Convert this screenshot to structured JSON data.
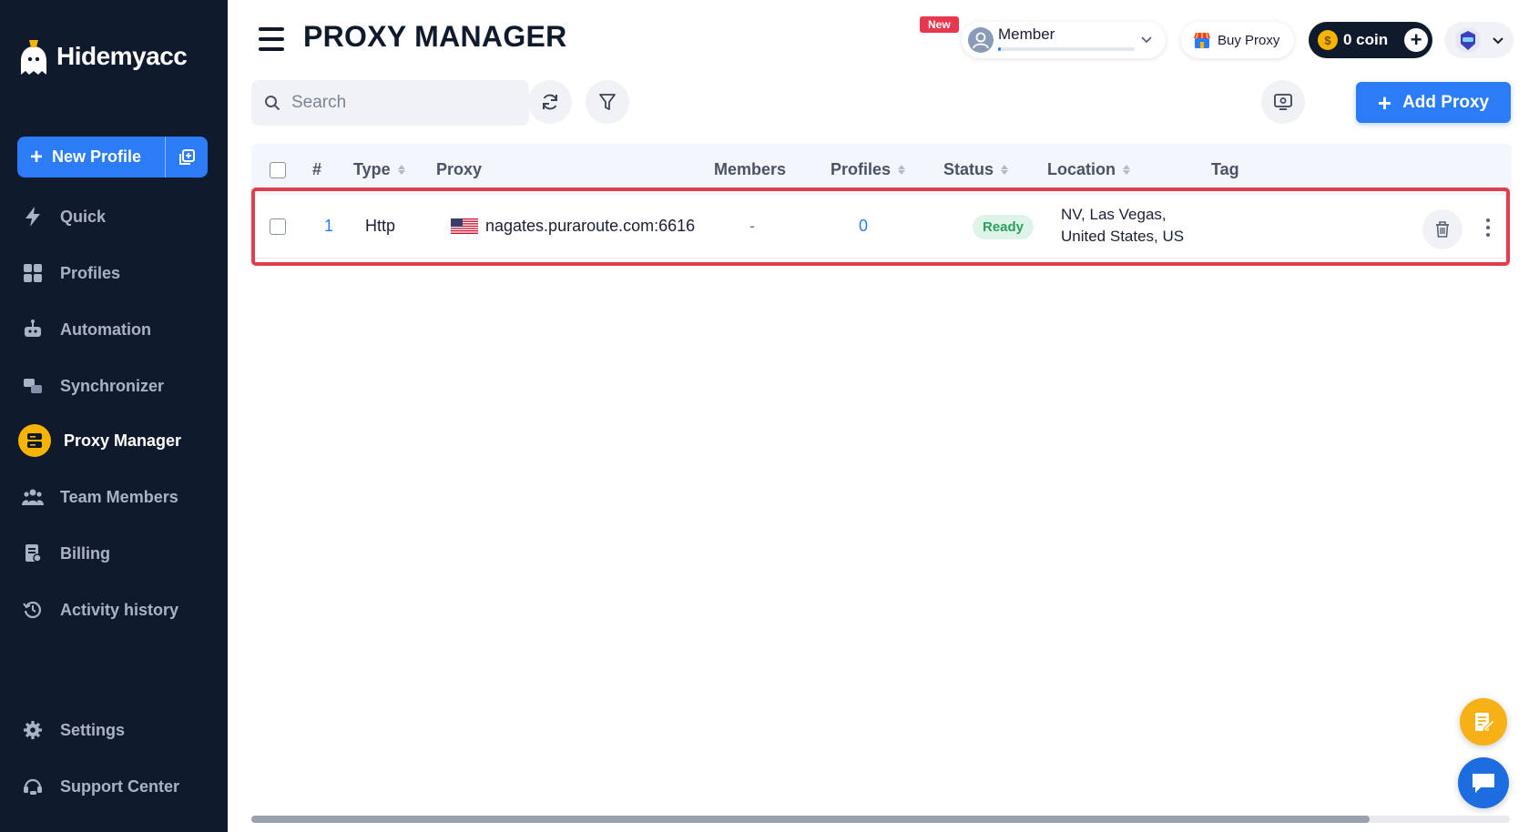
{
  "brand": {
    "name": "Hidemyacc"
  },
  "sidebar": {
    "new_profile_label": "New Profile",
    "items": [
      {
        "label": "Quick",
        "icon": "bolt-icon"
      },
      {
        "label": "Profiles",
        "icon": "grid-icon"
      },
      {
        "label": "Automation",
        "icon": "robot-icon"
      },
      {
        "label": "Synchronizer",
        "icon": "sync-icon"
      },
      {
        "label": "Proxy Manager",
        "icon": "server-icon",
        "active": true
      },
      {
        "label": "Team Members",
        "icon": "team-icon"
      },
      {
        "label": "Billing",
        "icon": "billing-icon"
      },
      {
        "label": "Activity history",
        "icon": "history-icon"
      },
      {
        "label": "Settings",
        "icon": "gear-icon"
      },
      {
        "label": "Support Center",
        "icon": "support-icon"
      }
    ]
  },
  "header": {
    "title": "PROXY MANAGER",
    "new_badge": "New",
    "member_label": "Member",
    "buy_proxy_label": "Buy Proxy",
    "coin_label": "0 coin"
  },
  "toolbar": {
    "search_placeholder": "Search",
    "add_proxy_label": "Add Proxy"
  },
  "table": {
    "columns": [
      "#",
      "Type",
      "Proxy",
      "Members",
      "Profiles",
      "Status",
      "Location",
      "Tag"
    ],
    "rows": [
      {
        "index": "1",
        "type": "Http",
        "proxy": "nagates.puraroute.com:6616",
        "members": "-",
        "profiles": "0",
        "status": "Ready",
        "location_line1": "NV, Las Vegas,",
        "location_line2": "United States, US",
        "tag": ""
      }
    ]
  },
  "colors": {
    "sidebar_bg": "#0f1a2c",
    "accent": "#2b7cf6",
    "active_icon": "#f4b400",
    "status_ready": "#2aa05f",
    "highlight": "#e23d4a"
  }
}
